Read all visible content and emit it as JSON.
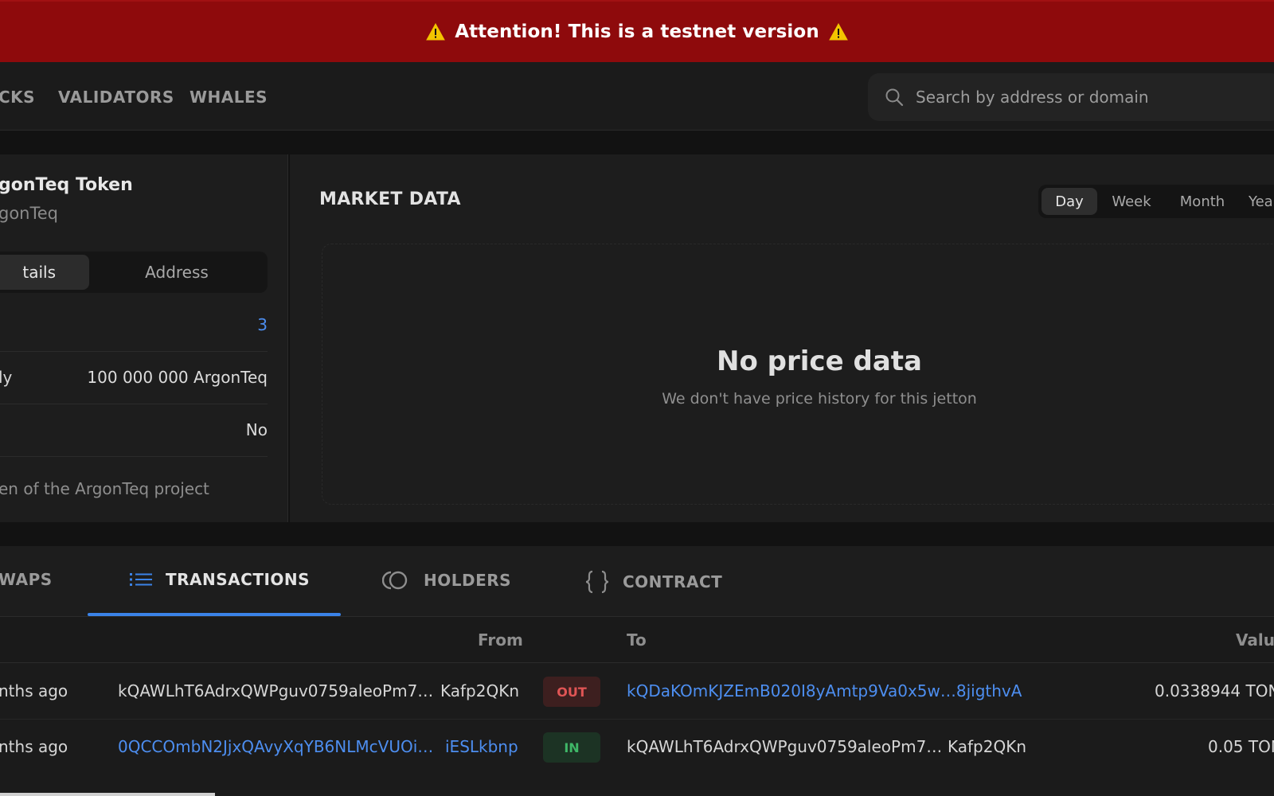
{
  "banner": {
    "text": "Attention! This is a testnet version"
  },
  "nav": {
    "items": [
      "CKS",
      "VALIDATORS",
      "WHALES"
    ],
    "search_placeholder": "Search by address or domain"
  },
  "token": {
    "name": "gonTeq Token",
    "symbol": "gonTeq",
    "segments": [
      "tails",
      "Address"
    ],
    "rows": [
      {
        "label": "",
        "value": "3"
      },
      {
        "label": "ly",
        "value": "100 000 000 ArgonTeq"
      },
      {
        "label": "",
        "value": "No"
      }
    ],
    "description": "en of the ArgonTeq project"
  },
  "market": {
    "title": "MARKET DATA",
    "periods": [
      "Day",
      "Week",
      "Month",
      "Yea"
    ],
    "active_period": "Day",
    "empty_title": "No price data",
    "empty_subtitle": "We don't have price history for this jetton"
  },
  "tabs": {
    "items": [
      "WAPS",
      "TRANSACTIONS",
      "HOLDERS",
      "CONTRACT"
    ],
    "active": "TRANSACTIONS"
  },
  "table": {
    "columns": [
      "From",
      "To",
      "Valu"
    ],
    "rows": [
      {
        "time": "nths ago",
        "from": "kQAWLhT6AdrxQWPguv0759aleoPm7…",
        "from_tail": "Kafp2QKn",
        "direction": "OUT",
        "to": "kQDaKOmKJZEmB020I8yAmtp9Va0x5w…8jigthvA",
        "value": "0.0338944 TON"
      },
      {
        "time": "nths ago",
        "from": "0QCCOmbN2JjxQAvyXqYB6NLMcVUOi…",
        "from_tail": "iESLkbnp",
        "direction": "IN",
        "to": "kQAWLhT6AdrxQWPguv0759aleoPm7…",
        "to_tail": "Kafp2QKn",
        "value": "0.05 TON"
      }
    ]
  },
  "colors": {
    "banner": "#8e0a0c",
    "accent": "#3b83e8",
    "link": "#4d8ef0",
    "out": "#e05555",
    "in": "#3fb767"
  },
  "icons": [
    "warning-icon",
    "search-icon",
    "list-icon",
    "holders-icon",
    "code-braces-icon"
  ]
}
